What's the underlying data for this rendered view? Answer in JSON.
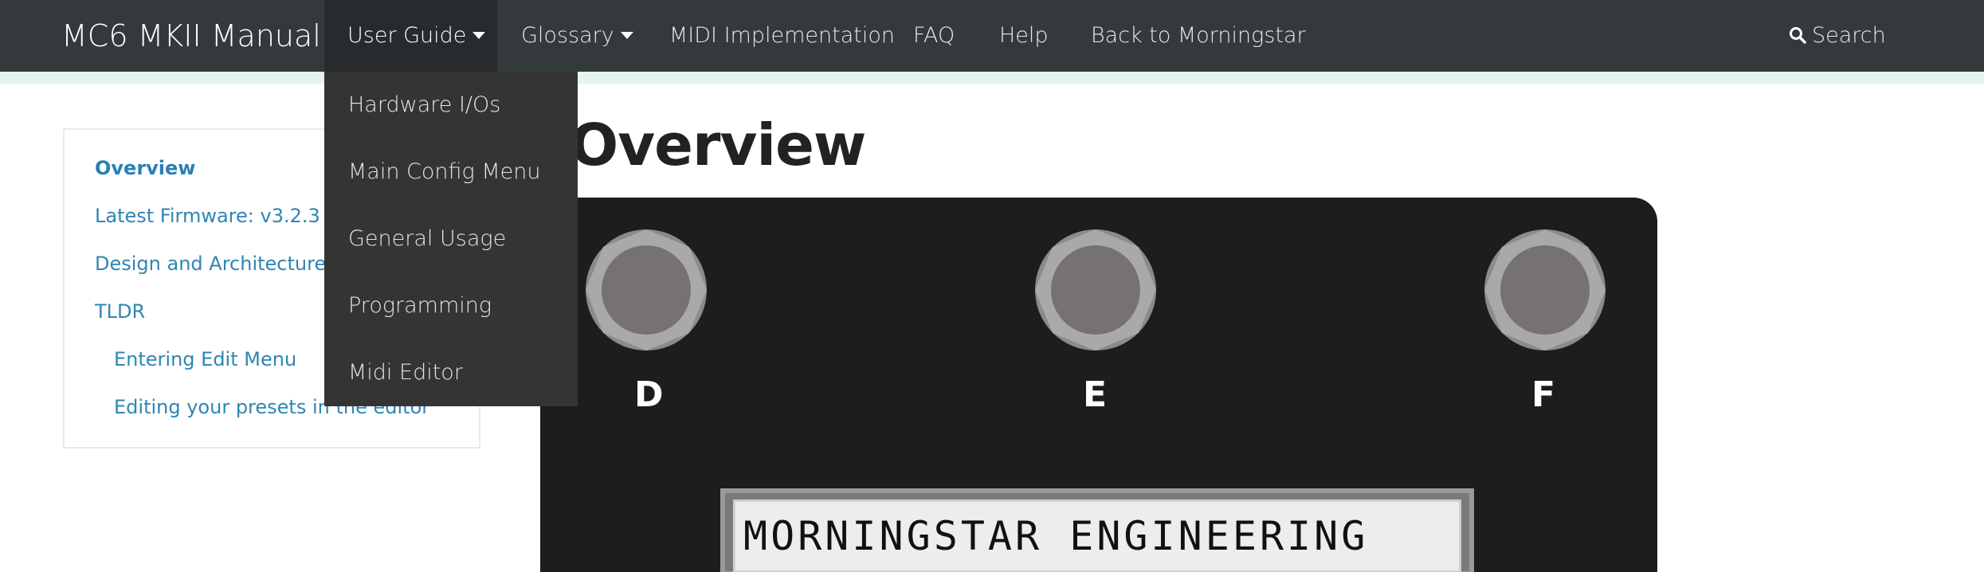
{
  "navbar": {
    "brand": "MC6 MKII Manual",
    "items": [
      {
        "label": "User Guide"
      },
      {
        "label": "Glossary"
      },
      {
        "label": "MIDI Implementation"
      },
      {
        "label": "FAQ"
      },
      {
        "label": "Help"
      },
      {
        "label": "Back to Morningstar"
      }
    ],
    "search_label": "Search"
  },
  "dropdown": {
    "items": [
      "Hardware I/Os",
      "Main Config Menu",
      "General Usage",
      "Programming",
      "Midi Editor"
    ]
  },
  "sidebar": {
    "items": [
      {
        "label": "Overview"
      },
      {
        "label": "Latest Firmware: v3.2.3"
      },
      {
        "label": "Design and Architecture"
      },
      {
        "label": "TLDR"
      },
      {
        "label": "Entering Edit Menu"
      },
      {
        "label": "Editing your presets in the editor"
      }
    ]
  },
  "main": {
    "title": "Overview",
    "device": {
      "switch_labels": [
        "D",
        "E",
        "F"
      ],
      "lcd_text": "MORNINGSTAR ENGINEERING"
    }
  },
  "colors": {
    "navbar_bg": "#343a3c",
    "dropdown_bg": "#343434",
    "link": "#2e86b3",
    "device_bg": "#1d1d1d"
  }
}
